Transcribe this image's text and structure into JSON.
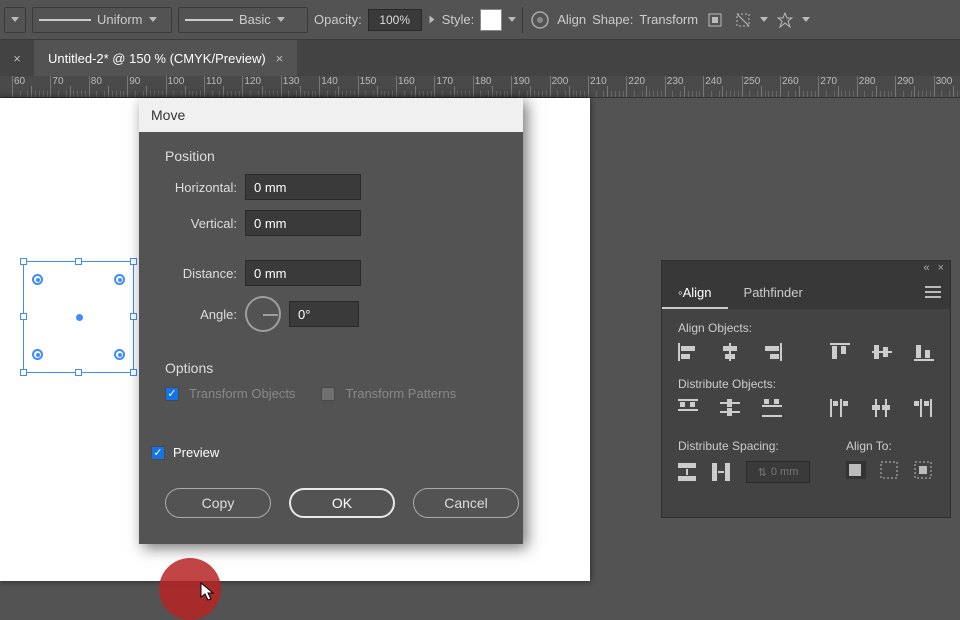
{
  "toolbar": {
    "stroke_profile": "Uniform",
    "brush_profile": "Basic",
    "opacity_label": "Opacity:",
    "opacity_value": "100%",
    "style_label": "Style:",
    "align_label": "Align",
    "shape_label": "Shape:",
    "transform_label": "Transform"
  },
  "tab": {
    "title": "Untitled-2* @ 150 % (CMYK/Preview)"
  },
  "ruler": {
    "labels": [
      "60",
      "70",
      "80",
      "90",
      "100",
      "110",
      "120",
      "130",
      "140",
      "150",
      "160",
      "170",
      "180",
      "190",
      "200",
      "210",
      "220",
      "230",
      "240",
      "250",
      "260",
      "270",
      "280",
      "290",
      "300"
    ]
  },
  "dialog": {
    "title": "Move",
    "position_label": "Position",
    "horizontal_label": "Horizontal:",
    "horizontal_value": "0 mm",
    "vertical_label": "Vertical:",
    "vertical_value": "0 mm",
    "distance_label": "Distance:",
    "distance_value": "0 mm",
    "angle_label": "Angle:",
    "angle_value": "0°",
    "options_label": "Options",
    "transform_objects_label": "Transform Objects",
    "transform_patterns_label": "Transform Patterns",
    "preview_label": "Preview",
    "copy_btn": "Copy",
    "ok_btn": "OK",
    "cancel_btn": "Cancel"
  },
  "panel": {
    "tab_align": "Align",
    "tab_pathfinder": "Pathfinder",
    "align_objects_label": "Align Objects:",
    "distribute_objects_label": "Distribute Objects:",
    "distribute_spacing_label": "Distribute Spacing:",
    "align_to_label": "Align To:",
    "spacing_value": "0 mm"
  }
}
